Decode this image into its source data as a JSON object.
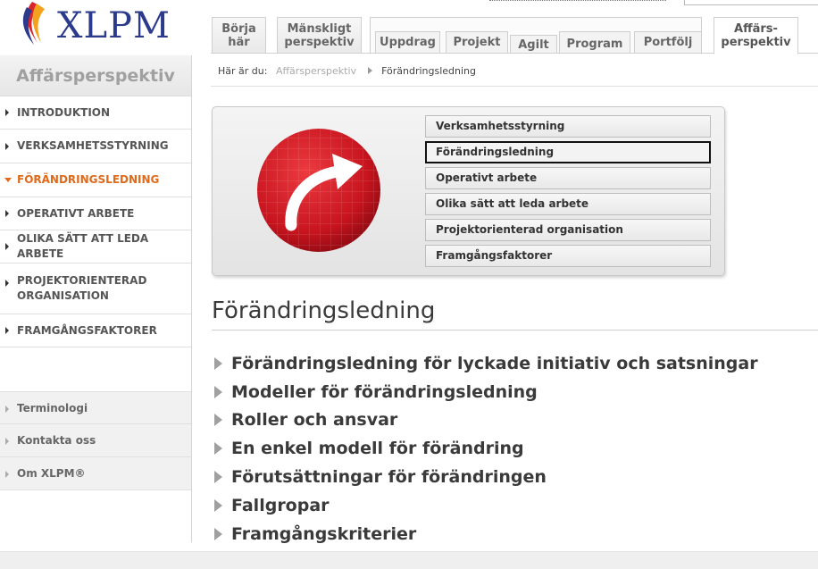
{
  "header": {
    "logo_text": "XLPM",
    "tabs": [
      {
        "id": "borja",
        "label_line1": "Börja",
        "label_line2": "här"
      },
      {
        "id": "manskligt",
        "label_line1": "Mänskligt",
        "label_line2": "perspektiv"
      },
      {
        "id": "uppdrag",
        "label_line1": "Uppdrag"
      },
      {
        "id": "projekt",
        "label_line1": "Projekt"
      },
      {
        "id": "agilt",
        "label_line1": "Agilt"
      },
      {
        "id": "program",
        "label_line1": "Program"
      },
      {
        "id": "portfolj",
        "label_line1": "Portfölj"
      },
      {
        "id": "affars",
        "label_line1": "Affärs-",
        "label_line2": "perspektiv"
      }
    ]
  },
  "sidebar": {
    "title": "Affärsperspektiv",
    "items": [
      {
        "label": "INTRODUKTION",
        "active": false
      },
      {
        "label": "VERKSAMHETSSTYRNING",
        "active": false
      },
      {
        "label": "FÖRÄNDRINGSLEDNING",
        "active": true
      },
      {
        "label": "OPERATIVT ARBETE",
        "active": false
      },
      {
        "label": "OLIKA SÄTT ATT LEDA ARBETE",
        "active": false
      },
      {
        "label": "PROJEKTORIENTERAD ORGANISATION",
        "active": false
      },
      {
        "label": "FRAMGÅNGSFAKTORER",
        "active": false
      }
    ],
    "secondary": [
      {
        "label": "Terminologi"
      },
      {
        "label": "Kontakta oss"
      },
      {
        "label": "Om XLPM®"
      }
    ]
  },
  "breadcrumb": {
    "prefix": "Här är du:",
    "link": "Affärsperspektiv",
    "current": "Förändringsledning"
  },
  "hero": {
    "icon": "curved-arrow-icon",
    "accent": "#c8141e",
    "items": [
      {
        "label": "Verksamhetsstyrning",
        "selected": false
      },
      {
        "label": "Förändringsledning",
        "selected": true
      },
      {
        "label": "Operativt arbete",
        "selected": false
      },
      {
        "label": "Olika sätt att leda arbete",
        "selected": false
      },
      {
        "label": "Projektorienterad organisation",
        "selected": false
      },
      {
        "label": "Framgångsfaktorer",
        "selected": false
      }
    ]
  },
  "main": {
    "title": "Förändringsledning",
    "sections": [
      "Förändringsledning för lyckade initiativ och satsningar",
      "Modeller för förändringsledning",
      "Roller och ansvar",
      "En enkel modell för förändring",
      "Förutsättningar för förändringen",
      "Fallgropar",
      "Framgångskriterier"
    ]
  },
  "colors": {
    "active_nav": "#e06a1b",
    "logo_blue": "#2b3a8a"
  }
}
